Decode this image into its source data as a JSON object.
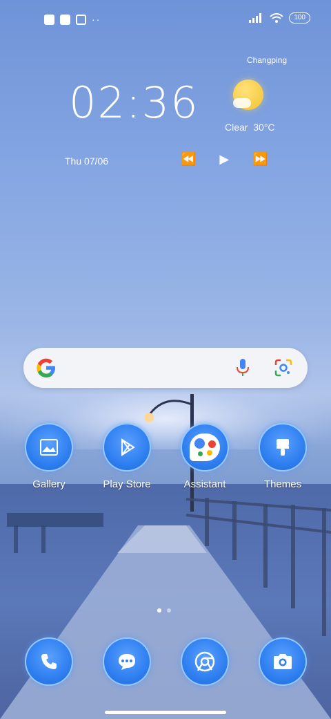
{
  "status_bar": {
    "battery": "100",
    "overflow_dots": "··"
  },
  "weather_widget": {
    "location": "Changping",
    "time": "02:36",
    "condition": "Clear",
    "temperature": "30°C",
    "date": "Thu 07/06"
  },
  "media_controls": {
    "prev": "⏪",
    "play": "▶",
    "next": "⏩"
  },
  "apps": [
    {
      "label": "Gallery",
      "icon": "gallery-icon"
    },
    {
      "label": "Play Store",
      "icon": "play-store-icon"
    },
    {
      "label": "Assistant",
      "icon": "assistant-icon"
    },
    {
      "label": "Themes",
      "icon": "brush-icon"
    }
  ],
  "dock": [
    {
      "icon": "phone-icon"
    },
    {
      "icon": "messages-icon"
    },
    {
      "icon": "chrome-icon"
    },
    {
      "icon": "camera-icon"
    }
  ],
  "page_indicator": {
    "pages": 2,
    "current": 1
  },
  "colors": {
    "icon_blue": "#2f7ff0",
    "search_bg": "#f3f4f8"
  }
}
